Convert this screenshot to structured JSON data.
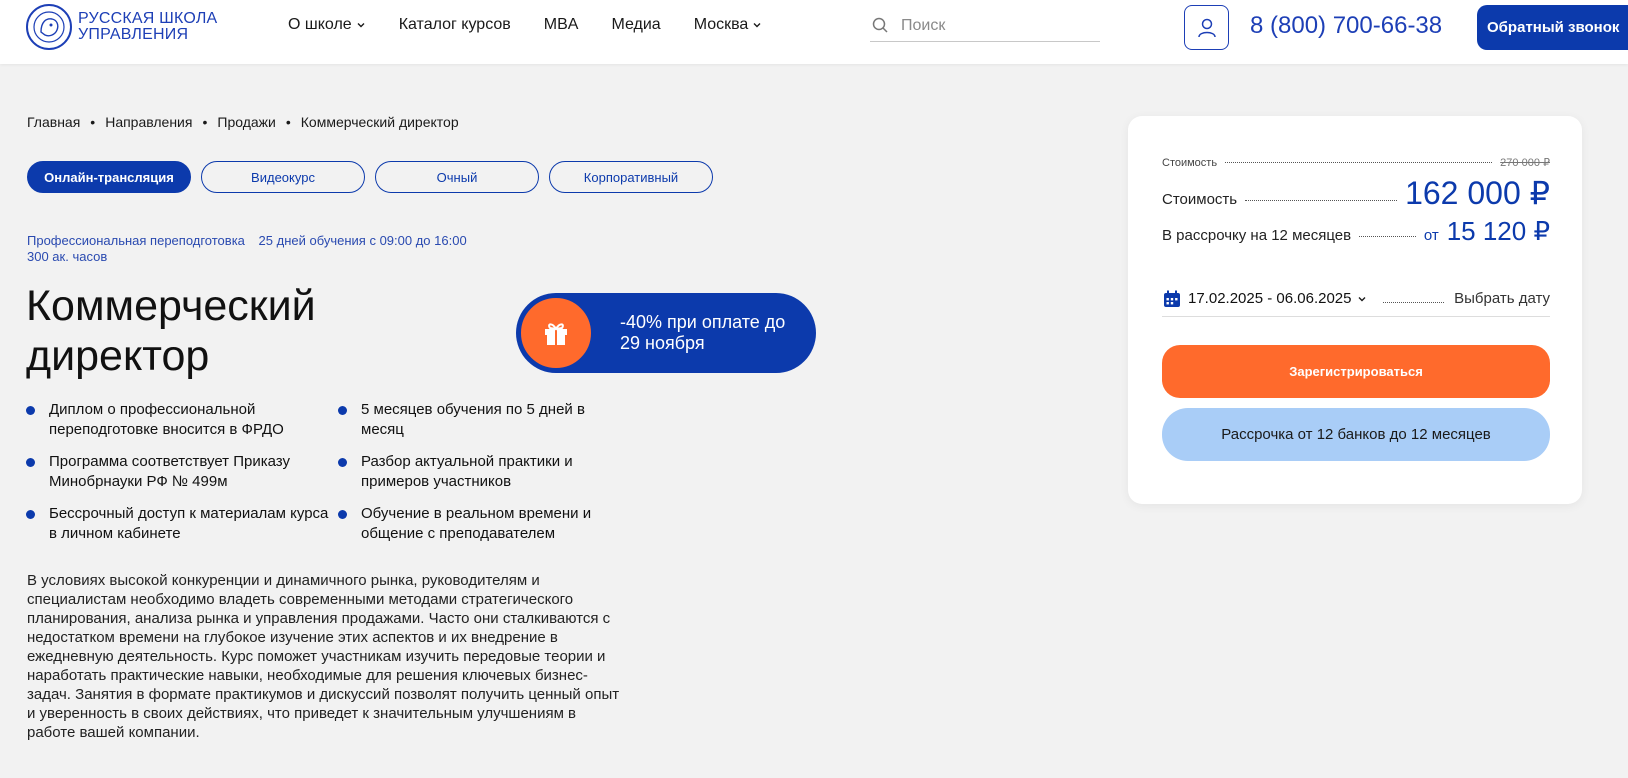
{
  "header": {
    "logo_line1": "РУССКАЯ ШКОЛА",
    "logo_line2": "УПРАВЛЕНИЯ",
    "nav": [
      {
        "label": "О школе",
        "dropdown": true
      },
      {
        "label": "Каталог курсов",
        "dropdown": false
      },
      {
        "label": "MBA",
        "dropdown": false
      },
      {
        "label": "Медиа",
        "dropdown": false
      },
      {
        "label": "Москва",
        "dropdown": true
      }
    ],
    "search_placeholder": "Поиск",
    "phone": "8 (800) 700-66-38",
    "callback_label": "Обратный звонок"
  },
  "breadcrumb": [
    "Главная",
    "Направления",
    "Продажи",
    "Коммерческий директор"
  ],
  "formats": [
    {
      "label": "Онлайн-трансляция",
      "active": true
    },
    {
      "label": "Видеокурс",
      "active": false
    },
    {
      "label": "Очный",
      "active": false
    },
    {
      "label": "Корпоративный",
      "active": false
    }
  ],
  "meta": {
    "program_type": "Профессиональная переподготовка",
    "schedule": "25 дней обучения с 09:00 до 16:00",
    "hours": "300 ак. часов"
  },
  "title": "Коммерческий директор",
  "promo": {
    "text": "-40% при оплате до 29 ноября",
    "icon": "gift-icon"
  },
  "features": [
    "Диплом о профессиональной переподготовке вносится в ФРДО",
    "5 месяцев обучения по 5 дней в месяц",
    "Программа соответствует Приказу Минобрнауки РФ № 499м",
    "Разбор актуальной практики и примеров участников",
    "Бессрочный доступ к материалам курса в личном кабинете",
    "Обучение в реальном времени и общение с преподавателем"
  ],
  "description": "В условиях высокой конкуренции и динамичного рынка, руководителям и специалистам необходимо владеть современными методами стратегического планирования, анализа рынка и управления продажами. Часто они сталкиваются с недостатком времени на глубокое изучение этих аспектов и их внедрение в ежедневную деятельность. Курс поможет участникам изучить передовые теории и наработать практические навыки, необходимые для решения ключевых бизнес-задач. Занятия в формате практикумов и дискуссий позволят получить ценный опыт и уверенность в своих действиях, что приведет к значительным улучшениям в работе вашей компании.",
  "price_card": {
    "old_label": "Стоимость",
    "old_price": "270 000 ₽",
    "current_label": "Стоимость",
    "current_price": "162 000 ₽",
    "installment_label": "В рассрочку на 12 месяцев",
    "installment_from": "от",
    "installment_price": "15 120 ₽",
    "date_range": "17.02.2025 - 06.06.2025",
    "choose_date": "Выбрать дату",
    "register_label": "Зарегистрироваться",
    "installment_button": "Рассрочка от 12 банков до 12 месяцев"
  },
  "colors": {
    "brand_blue": "#0c3aac",
    "accent_orange": "#ff6a2c",
    "light_blue": "#a9cdf7"
  }
}
